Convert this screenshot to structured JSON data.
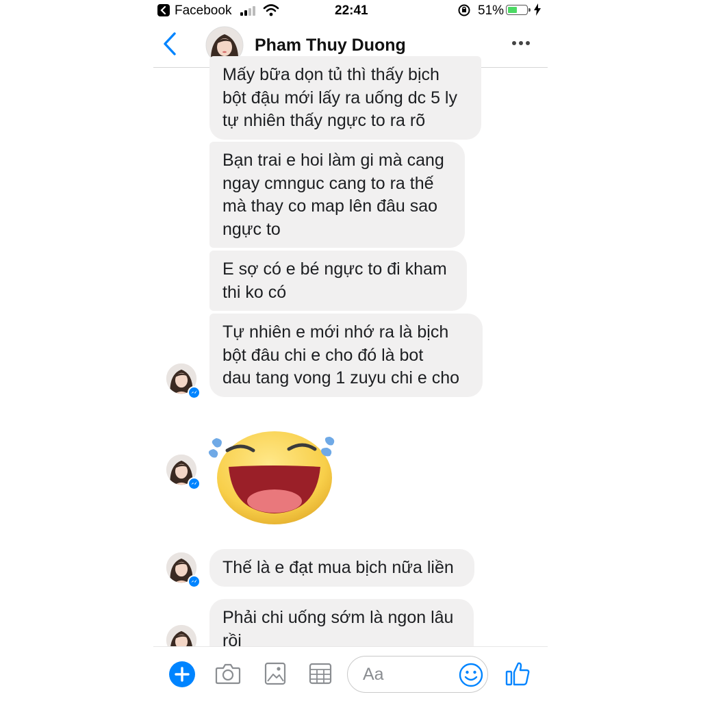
{
  "status_bar": {
    "back_app": "Facebook",
    "time": "22:41",
    "battery_percent": "51%",
    "battery_level": 0.51,
    "icons": [
      "back-to-app-icon",
      "cellular-signal-icon",
      "wifi-icon",
      "orientation-lock-icon",
      "battery-icon",
      "charging-bolt-icon"
    ]
  },
  "header": {
    "contact_name": "Pham Thuy Duong",
    "icons": [
      "back-chevron-icon",
      "contact-avatar",
      "more-options-icon"
    ],
    "accent_color": "#0084ff"
  },
  "messages": [
    {
      "text": "Mấy bữa dọn tủ thì thấy bịch\nbột đậu mới lấy ra uống dc 5 ly\ntự nhiên thấy ngực to ra rõ"
    },
    {
      "text": "Bạn trai e hoi làm gi mà cang\nngay cmnguc cang to ra thế\nmà thay co map lên đâu sao\nngực to"
    },
    {
      "text": "E sợ có e bé ngực to đi kham\nthi ko có"
    },
    {
      "text": "Tự nhiên e mới nhớ ra là bịch\nbột đâu chi e cho đó là bot\ndau tang vong 1 zuyu chi e cho"
    },
    {
      "sticker": "laughing-tears-sticker"
    },
    {
      "text": "Thế là e đạt mua bịch nữa liền"
    },
    {
      "text": "Phải chi uống sớm là ngon lâu\nrồi"
    }
  ],
  "composer": {
    "placeholder": "Aa",
    "icons": [
      "add-plus-icon",
      "camera-icon",
      "gallery-icon",
      "grid-table-icon",
      "emoji-smile-icon",
      "thumbs-up-icon"
    ]
  },
  "colors": {
    "bubble_bg": "#f1f0f0",
    "accent": "#0084ff",
    "battery_green": "#4cd964"
  }
}
